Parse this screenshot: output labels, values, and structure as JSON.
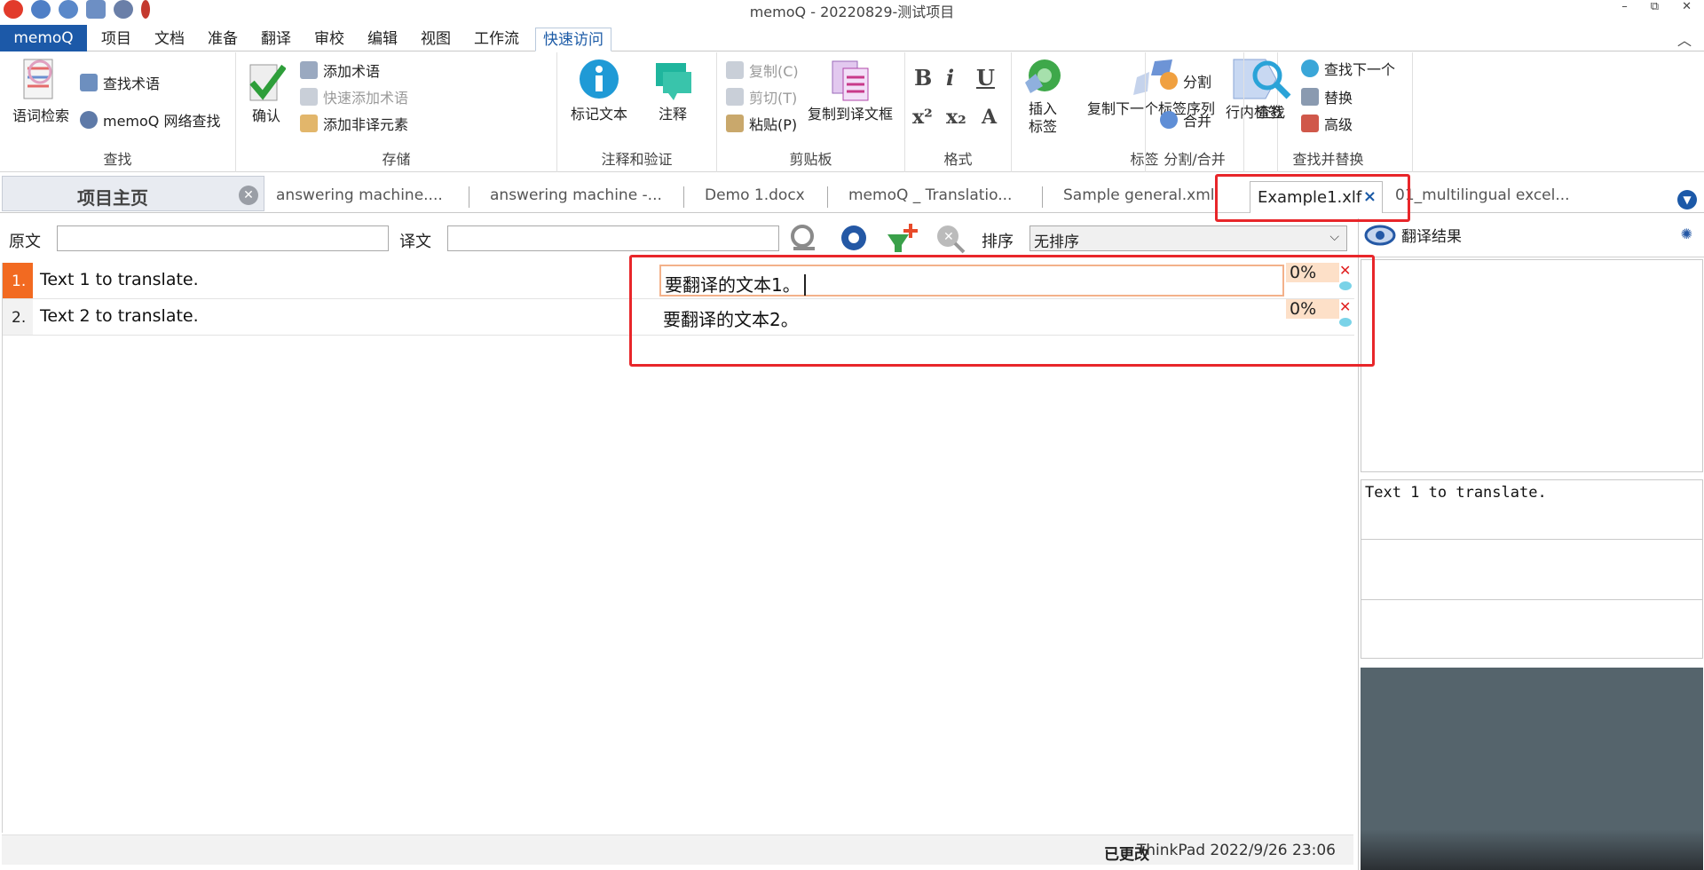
{
  "window": {
    "title": "memoQ - 20220829-测试项目",
    "controls": [
      "–",
      "⧉",
      "✕"
    ]
  },
  "ribbon_tabs": [
    {
      "label": "memoQ"
    },
    {
      "label": "项目"
    },
    {
      "label": "文档"
    },
    {
      "label": "准备"
    },
    {
      "label": "翻译"
    },
    {
      "label": "审校"
    },
    {
      "label": "编辑"
    },
    {
      "label": "视图"
    },
    {
      "label": "工作流"
    },
    {
      "label": "快速访问"
    }
  ],
  "ribbon": {
    "find": {
      "label": "查找",
      "concordance": "语词检索",
      "lookup_term": "查找术语",
      "web_search": "memoQ 网络查找"
    },
    "store": {
      "label": "存储",
      "confirm": "确认",
      "add_term": "添加术语",
      "quick_add_term": "快速添加术语",
      "add_nontranslatable": "添加非译元素"
    },
    "comments": {
      "label": "注释和验证",
      "mark_text": "标记文本",
      "comment": "注释"
    },
    "clipboard": {
      "label": "剪贴板",
      "copy": "复制(C)",
      "cut": "剪切(T)",
      "paste": "粘贴(P)",
      "copy_source": "复制到译文框"
    },
    "format": {
      "label": "格式",
      "bold": "B",
      "italic": "i",
      "underline": "U",
      "superscript": "x²",
      "subscript": "x₂"
    },
    "tags": {
      "label": "标签",
      "insert_tag": "插入\n标签",
      "copy_next_tag": "复制下一个标签序列",
      "inline_tags": "行内标签"
    },
    "split_join": {
      "label": "分割/合并",
      "split": "分割",
      "join": "合并"
    },
    "find_replace": {
      "label": "查找并替换",
      "find": "查找",
      "find_next": "查找下一个",
      "replace": "替换",
      "advanced": "高级"
    }
  },
  "doc_tabs": {
    "home": "项目主页",
    "tabs": [
      "answering machine....",
      "answering machine -...",
      "Demo 1.docx",
      "memoQ _ Translatio...",
      "Sample general.xml",
      "01_multilingual excel..."
    ],
    "active": "Example1.xlf"
  },
  "filter": {
    "source_label": "原文",
    "target_label": "译文",
    "source_value": "",
    "target_value": "",
    "sort_label": "排序",
    "sort_value": "无排序"
  },
  "segments": [
    {
      "num": "1.",
      "source": "Text 1 to translate.",
      "target": "要翻译的文本1。",
      "match": "0%"
    },
    {
      "num": "2.",
      "source": "Text 2 to translate.",
      "target": "要翻译的文本2。",
      "match": "0%"
    }
  ],
  "status": {
    "state": "已更改",
    "info": "ThinkPad 2022/9/26 23:06"
  },
  "right_panel": {
    "title": "翻译结果",
    "source_preview": "Text 1 to translate."
  },
  "colors": {
    "accent": "#1c59a8",
    "active_row_num": "#f26a21",
    "highlight": "#e8262a",
    "match_bg": "#fde0c8"
  }
}
